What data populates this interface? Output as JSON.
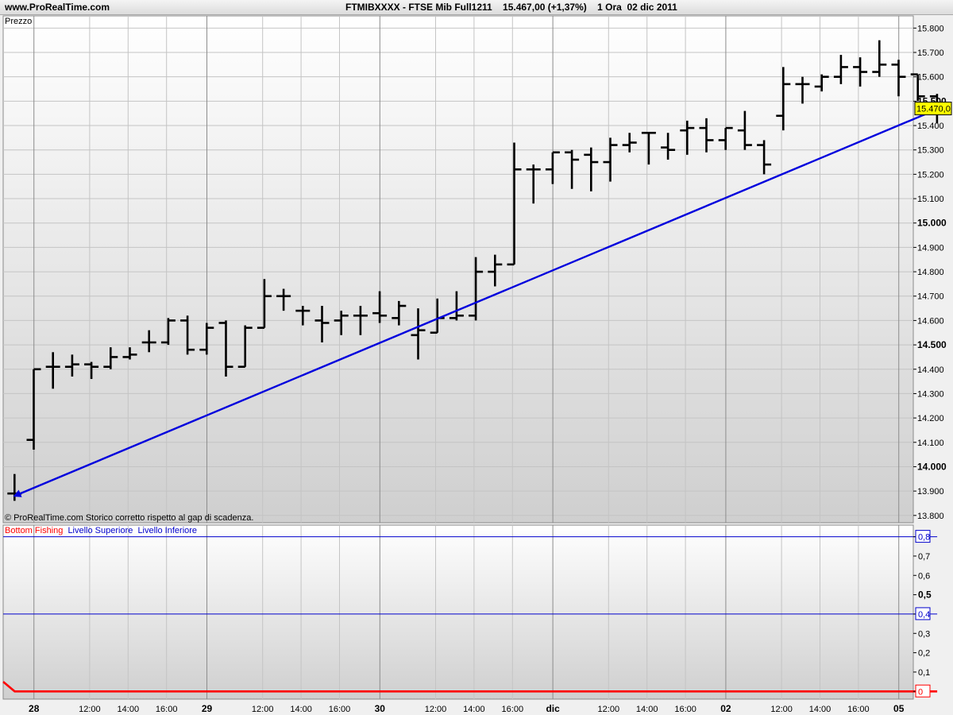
{
  "header": {
    "site": "www.ProRealTime.com",
    "instrument": "FTMIBXXXX - FTSE Mib Full1211    15.467,00 (+1,37%)    1 Ora  02 dic 2011"
  },
  "price_panel": {
    "label": "Prezzo",
    "footnote": "© ProRealTime.com  Storico corretto rispetto al gap di scadenza.",
    "last_price_label": "15.470,0",
    "last_price": 15470
  },
  "indicator_panel": {
    "legend": [
      {
        "text": "Bottom Fishing",
        "color": "#ff0000"
      },
      {
        "text": "Livello Superiore",
        "color": "#0000cc"
      },
      {
        "text": "Livello Inferiore",
        "color": "#0000cc"
      }
    ],
    "upper_level": 0.8,
    "lower_level": 0.4
  },
  "colors": {
    "bars": "#000000",
    "trendline": "#0000dd",
    "bottom_fishing": "#ff0000",
    "levels": "#0000cc",
    "last_price_bg": "#ffff00"
  },
  "chart_data": [
    {
      "type": "ohlc",
      "title": "FTMIBXXXX - FTSE Mib Full1211",
      "ylabel": "Prezzo",
      "ylim": [
        13770,
        15850
      ],
      "y_ticks": [
        {
          "value": 13800,
          "label": "13.800"
        },
        {
          "value": 13900,
          "label": "13.900"
        },
        {
          "value": 14000,
          "label": "14.000",
          "bold": true
        },
        {
          "value": 14100,
          "label": "14.100"
        },
        {
          "value": 14200,
          "label": "14.200"
        },
        {
          "value": 14300,
          "label": "14.300"
        },
        {
          "value": 14400,
          "label": "14.400"
        },
        {
          "value": 14500,
          "label": "14.500",
          "bold": true
        },
        {
          "value": 14600,
          "label": "14.600"
        },
        {
          "value": 14700,
          "label": "14.700"
        },
        {
          "value": 14800,
          "label": "14.800"
        },
        {
          "value": 14900,
          "label": "14.900"
        },
        {
          "value": 15000,
          "label": "15.000",
          "bold": true
        },
        {
          "value": 15100,
          "label": "15.100"
        },
        {
          "value": 15200,
          "label": "15.200"
        },
        {
          "value": 15300,
          "label": "15.300"
        },
        {
          "value": 15400,
          "label": "15.400"
        },
        {
          "value": 15500,
          "label": "15.500",
          "bold": true
        },
        {
          "value": 15600,
          "label": "15.600"
        },
        {
          "value": 15700,
          "label": "15.700"
        },
        {
          "value": 15800,
          "label": "15.800"
        }
      ],
      "x_ticks": [
        {
          "x": 1.6,
          "label": "28",
          "bold": true,
          "day": true
        },
        {
          "x": 4.5,
          "label": "12:00"
        },
        {
          "x": 6.5,
          "label": "14:00"
        },
        {
          "x": 8.5,
          "label": "16:00"
        },
        {
          "x": 10.6,
          "label": "29",
          "bold": true,
          "day": true
        },
        {
          "x": 13.5,
          "label": "12:00"
        },
        {
          "x": 15.5,
          "label": "14:00"
        },
        {
          "x": 17.5,
          "label": "16:00"
        },
        {
          "x": 19.6,
          "label": "30",
          "bold": true,
          "day": true
        },
        {
          "x": 22.5,
          "label": "12:00"
        },
        {
          "x": 24.5,
          "label": "14:00"
        },
        {
          "x": 26.5,
          "label": "16:00"
        },
        {
          "x": 28.6,
          "label": "dic",
          "bold": true,
          "day": true
        },
        {
          "x": 31.5,
          "label": "12:00"
        },
        {
          "x": 33.5,
          "label": "14:00"
        },
        {
          "x": 35.5,
          "label": "16:00"
        },
        {
          "x": 37.6,
          "label": "02",
          "bold": true,
          "day": true
        },
        {
          "x": 40.5,
          "label": "12:00"
        },
        {
          "x": 42.5,
          "label": "14:00"
        },
        {
          "x": 44.5,
          "label": "16:00"
        },
        {
          "x": 46.6,
          "label": "05",
          "bold": true,
          "day": true
        }
      ],
      "xlim": [
        0,
        47.2
      ],
      "bars": [
        {
          "x": 0.5,
          "o": 13890,
          "h": 13970,
          "l": 13860,
          "c": 13890
        },
        {
          "x": 1.5,
          "o": 14110,
          "h": 14400,
          "l": 14070,
          "c": 14400
        },
        {
          "x": 2.5,
          "o": 14410,
          "h": 14470,
          "l": 14320,
          "c": 14410
        },
        {
          "x": 3.5,
          "o": 14410,
          "h": 14460,
          "l": 14370,
          "c": 14420
        },
        {
          "x": 4.5,
          "o": 14420,
          "h": 14430,
          "l": 14360,
          "c": 14410
        },
        {
          "x": 5.5,
          "o": 14410,
          "h": 14490,
          "l": 14400,
          "c": 14450
        },
        {
          "x": 6.5,
          "o": 14450,
          "h": 14490,
          "l": 14440,
          "c": 14460
        },
        {
          "x": 7.5,
          "o": 14510,
          "h": 14560,
          "l": 14470,
          "c": 14510
        },
        {
          "x": 8.5,
          "o": 14510,
          "h": 14610,
          "l": 14500,
          "c": 14600
        },
        {
          "x": 9.5,
          "o": 14600,
          "h": 14620,
          "l": 14460,
          "c": 14480
        },
        {
          "x": 10.5,
          "o": 14480,
          "h": 14590,
          "l": 14460,
          "c": 14570
        },
        {
          "x": 11.5,
          "o": 14590,
          "h": 14600,
          "l": 14370,
          "c": 14410
        },
        {
          "x": 12.5,
          "o": 14410,
          "h": 14580,
          "l": 14410,
          "c": 14570
        },
        {
          "x": 13.5,
          "o": 14570,
          "h": 14770,
          "l": 14570,
          "c": 14700
        },
        {
          "x": 14.5,
          "o": 14700,
          "h": 14730,
          "l": 14640,
          "c": 14700
        },
        {
          "x": 15.5,
          "o": 14640,
          "h": 14660,
          "l": 14580,
          "c": 14640
        },
        {
          "x": 16.5,
          "o": 14600,
          "h": 14660,
          "l": 14510,
          "c": 14590
        },
        {
          "x": 17.5,
          "o": 14600,
          "h": 14640,
          "l": 14540,
          "c": 14620
        },
        {
          "x": 18.5,
          "o": 14620,
          "h": 14660,
          "l": 14540,
          "c": 14620
        },
        {
          "x": 19.5,
          "o": 14630,
          "h": 14720,
          "l": 14590,
          "c": 14620
        },
        {
          "x": 20.5,
          "o": 14610,
          "h": 14680,
          "l": 14580,
          "c": 14660
        },
        {
          "x": 21.5,
          "o": 14540,
          "h": 14650,
          "l": 14440,
          "c": 14560
        },
        {
          "x": 22.5,
          "o": 14550,
          "h": 14690,
          "l": 14550,
          "c": 14610
        },
        {
          "x": 23.5,
          "o": 14610,
          "h": 14720,
          "l": 14600,
          "c": 14620
        },
        {
          "x": 24.5,
          "o": 14620,
          "h": 14860,
          "l": 14600,
          "c": 14800
        },
        {
          "x": 25.5,
          "o": 14800,
          "h": 14870,
          "l": 14740,
          "c": 14830
        },
        {
          "x": 26.5,
          "o": 14830,
          "h": 15330,
          "l": 14830,
          "c": 15220
        },
        {
          "x": 27.5,
          "o": 15220,
          "h": 15240,
          "l": 15080,
          "c": 15220
        },
        {
          "x": 28.5,
          "o": 15220,
          "h": 15290,
          "l": 15160,
          "c": 15290
        },
        {
          "x": 29.5,
          "o": 15290,
          "h": 15300,
          "l": 15140,
          "c": 15260
        },
        {
          "x": 30.5,
          "o": 15280,
          "h": 15310,
          "l": 15130,
          "c": 15250
        },
        {
          "x": 31.5,
          "o": 15250,
          "h": 15350,
          "l": 15170,
          "c": 15320
        },
        {
          "x": 32.5,
          "o": 15320,
          "h": 15370,
          "l": 15290,
          "c": 15330
        },
        {
          "x": 33.5,
          "o": 15370,
          "h": 15370,
          "l": 15240,
          "c": 15370
        },
        {
          "x": 34.5,
          "o": 15310,
          "h": 15370,
          "l": 15260,
          "c": 15300
        },
        {
          "x": 35.5,
          "o": 15380,
          "h": 15420,
          "l": 15280,
          "c": 15390
        },
        {
          "x": 36.5,
          "o": 15390,
          "h": 15430,
          "l": 15290,
          "c": 15340
        },
        {
          "x": 37.5,
          "o": 15340,
          "h": 15390,
          "l": 15300,
          "c": 15390
        },
        {
          "x": 38.5,
          "o": 15380,
          "h": 15460,
          "l": 15300,
          "c": 15320
        },
        {
          "x": 39.5,
          "o": 15320,
          "h": 15340,
          "l": 15200,
          "c": 15240
        },
        {
          "x": 40.5,
          "o": 15440,
          "h": 15640,
          "l": 15380,
          "c": 15570
        },
        {
          "x": 41.5,
          "o": 15570,
          "h": 15600,
          "l": 15490,
          "c": 15570
        },
        {
          "x": 42.5,
          "o": 15560,
          "h": 15610,
          "l": 15540,
          "c": 15600
        },
        {
          "x": 43.5,
          "o": 15600,
          "h": 15690,
          "l": 15570,
          "c": 15640
        },
        {
          "x": 44.5,
          "o": 15640,
          "h": 15680,
          "l": 15560,
          "c": 15620
        },
        {
          "x": 45.5,
          "o": 15620,
          "h": 15750,
          "l": 15600,
          "c": 15650
        },
        {
          "x": 46.5,
          "o": 15650,
          "h": 15670,
          "l": 15520,
          "c": 15600
        },
        {
          "x": 47.5,
          "o": 15610,
          "h": 15610,
          "l": 15500,
          "c": 15520
        },
        {
          "x": 48.5,
          "o": 15520,
          "h": 15530,
          "l": 15410,
          "c": 15470
        }
      ],
      "trendline": {
        "x1": 0.5,
        "y1": 13880,
        "x2": 48.6,
        "y2": 15470
      }
    },
    {
      "type": "line",
      "ylim": [
        -0.04,
        0.86
      ],
      "y_ticks": [
        {
          "value": 0,
          "label": "0",
          "boxed": true,
          "color": "#ff0000"
        },
        {
          "value": 0.1,
          "label": "0,1"
        },
        {
          "value": 0.2,
          "label": "0,2"
        },
        {
          "value": 0.3,
          "label": "0,3"
        },
        {
          "value": 0.4,
          "label": "0,4",
          "boxed": true,
          "color": "#0000cc"
        },
        {
          "value": 0.5,
          "label": "0,5",
          "bold": true
        },
        {
          "value": 0.6,
          "label": "0,6"
        },
        {
          "value": 0.7,
          "label": "0,7"
        },
        {
          "value": 0.8,
          "label": "0,8",
          "boxed": true,
          "color": "#0000cc"
        }
      ],
      "series": [
        {
          "name": "Bottom Fishing",
          "x": [
            0,
            0.6,
            48.6
          ],
          "values": [
            0.05,
            0.0,
            0.0
          ]
        },
        {
          "name": "Livello Superiore",
          "x": [
            0,
            48.6
          ],
          "values": [
            0.8,
            0.8
          ]
        },
        {
          "name": "Livello Inferiore",
          "x": [
            0,
            48.6
          ],
          "values": [
            0.4,
            0.4
          ]
        }
      ]
    }
  ]
}
